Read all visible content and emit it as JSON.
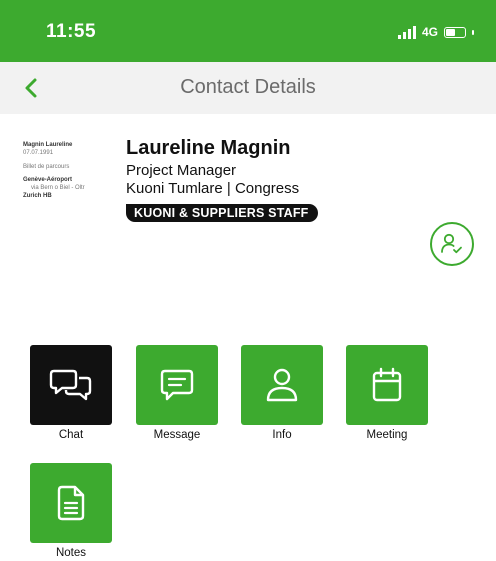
{
  "status_bar": {
    "time": "11:55",
    "network": "4G",
    "signal_bars": 4,
    "battery_level": 0.55
  },
  "header": {
    "title": "Contact Details",
    "back_icon": "chevron-left-icon"
  },
  "ticket": {
    "name": "Magnin Laureline",
    "date": "07.07.1991",
    "type": "Billet de parcours",
    "route_from": "Genève-Aéroport",
    "route_via": "via Bern o Biel - Oltr",
    "route_to": "Zurich HB"
  },
  "contact": {
    "name": "Laureline Magnin",
    "role": "Project Manager",
    "company": "Kuoni Tumlare | Congress",
    "badge": "KUONI & SUPPLIERS STAFF",
    "status_icon": "user-check-icon"
  },
  "actions": [
    {
      "label": "Chat",
      "icon": "chat-bubbles-icon"
    },
    {
      "label": "Message",
      "icon": "message-icon"
    },
    {
      "label": "Info",
      "icon": "user-icon"
    },
    {
      "label": "Meeting",
      "icon": "calendar-icon"
    },
    {
      "label": "Notes",
      "icon": "document-icon"
    }
  ],
  "colors": {
    "brand_green": "#3daa2f",
    "nav_bg": "#f2f2f2",
    "dark_tile": "#111111"
  }
}
